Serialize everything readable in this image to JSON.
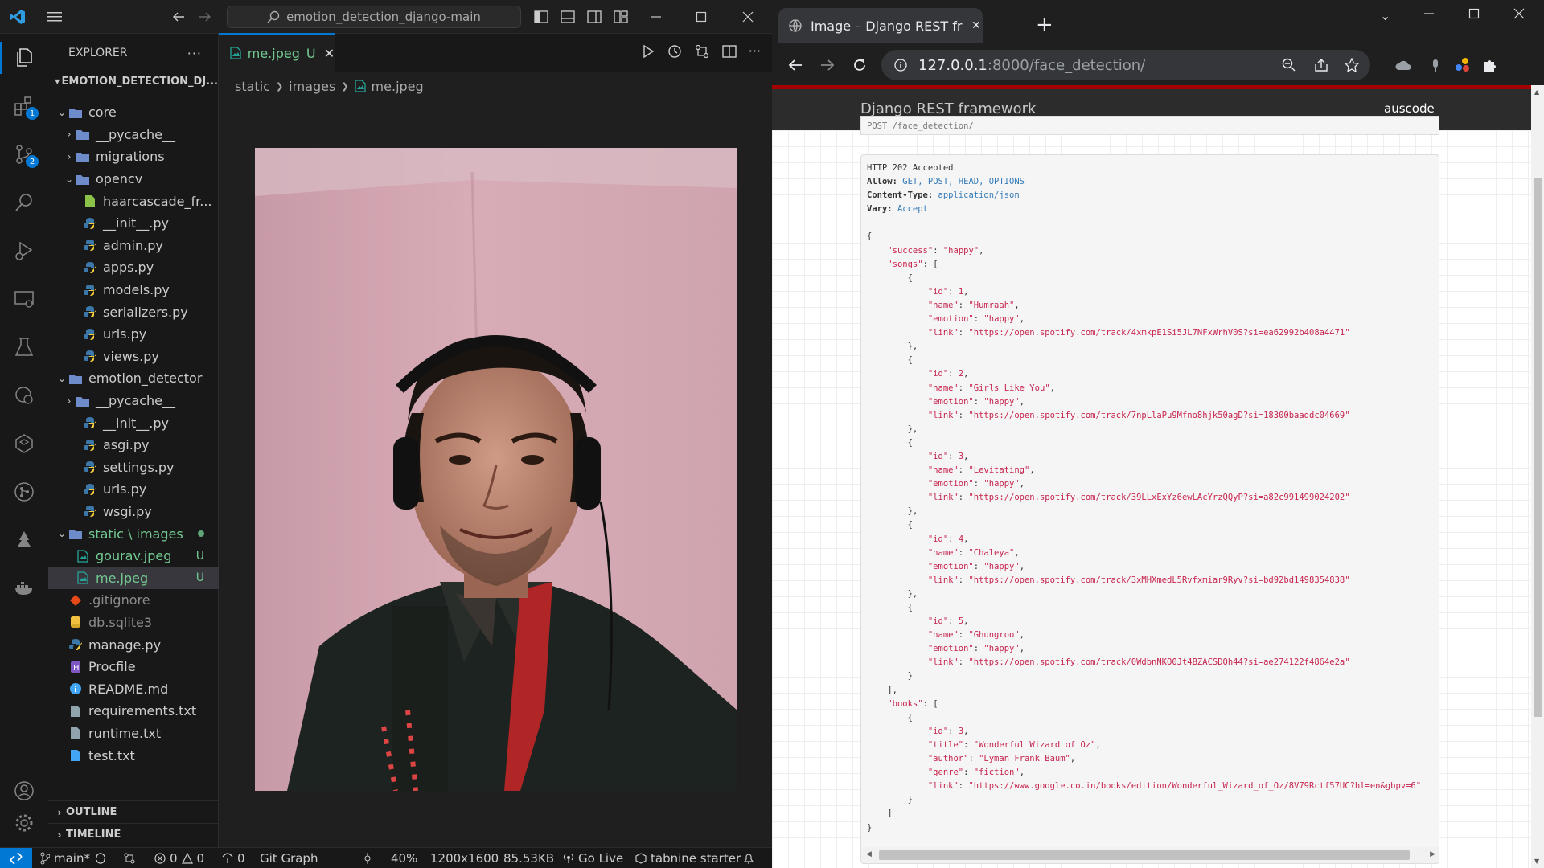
{
  "vscode": {
    "search_text": "emotion_detection_django-main",
    "explorer_title": "EXPLORER",
    "project_name": "EMOTION_DETECTION_DJ...",
    "activity_badges": {
      "extensions": "1",
      "source_control": "2"
    },
    "tree": [
      {
        "label": "core",
        "type": "folder",
        "open": true,
        "indent": 1
      },
      {
        "label": "__pycache__",
        "type": "folder",
        "open": false,
        "indent": 2
      },
      {
        "label": "migrations",
        "type": "folder",
        "open": false,
        "indent": 2
      },
      {
        "label": "opencv",
        "type": "folder",
        "open": true,
        "indent": 2
      },
      {
        "label": "haarcascade_fr...",
        "type": "xml",
        "indent": 3
      },
      {
        "label": "__init__.py",
        "type": "py",
        "indent": 3
      },
      {
        "label": "admin.py",
        "type": "py",
        "indent": 3
      },
      {
        "label": "apps.py",
        "type": "py",
        "indent": 3
      },
      {
        "label": "models.py",
        "type": "py",
        "indent": 3
      },
      {
        "label": "serializers.py",
        "type": "py",
        "indent": 3
      },
      {
        "label": "urls.py",
        "type": "py",
        "indent": 3
      },
      {
        "label": "views.py",
        "type": "py",
        "indent": 3
      },
      {
        "label": "emotion_detector",
        "type": "folder",
        "open": true,
        "indent": 1
      },
      {
        "label": "__pycache__",
        "type": "folder",
        "open": false,
        "indent": 2
      },
      {
        "label": "__init__.py",
        "type": "py",
        "indent": 3
      },
      {
        "label": "asgi.py",
        "type": "py",
        "indent": 3
      },
      {
        "label": "settings.py",
        "type": "py",
        "indent": 3
      },
      {
        "label": "urls.py",
        "type": "py",
        "indent": 3
      },
      {
        "label": "wsgi.py",
        "type": "py",
        "indent": 3
      },
      {
        "label": "static \\ images",
        "type": "folder",
        "open": true,
        "indent": 1,
        "git": "dot"
      },
      {
        "label": "gourav.jpeg",
        "type": "img",
        "indent": 2,
        "git": "U"
      },
      {
        "label": "me.jpeg",
        "type": "img",
        "indent": 2,
        "git": "U",
        "selected": true
      },
      {
        "label": ".gitignore",
        "type": "git",
        "indent": 1
      },
      {
        "label": "db.sqlite3",
        "type": "db",
        "indent": 1
      },
      {
        "label": "manage.py",
        "type": "py",
        "indent": 1
      },
      {
        "label": "Procfile",
        "type": "heroku",
        "indent": 1
      },
      {
        "label": "README.md",
        "type": "info",
        "indent": 1
      },
      {
        "label": "requirements.txt",
        "type": "txt",
        "indent": 1
      },
      {
        "label": "runtime.txt",
        "type": "txt",
        "indent": 1
      },
      {
        "label": "test.txt",
        "type": "txtblue",
        "indent": 1
      }
    ],
    "outline_label": "OUTLINE",
    "timeline_label": "TIMELINE",
    "tab": {
      "label": "me.jpeg",
      "status": "U"
    },
    "breadcrumb": [
      "static",
      "images",
      "me.jpeg"
    ],
    "status": {
      "branch": "main*",
      "errors": "0",
      "warnings": "0",
      "ports": "0",
      "git_graph": "Git Graph",
      "zoom": "40%",
      "dimensions": "1200x1600",
      "size": "85.53KB",
      "go_live": "Go Live",
      "tabnine": "tabnine starter"
    }
  },
  "browser": {
    "tab_title": "Image – Django REST framework",
    "url_host": "127.0.0.1",
    "url_path": ":8000/face_detection/",
    "drf_brand": "Django REST framework",
    "drf_user": "auscode",
    "prev_line": "POST /face_detection/",
    "response": {
      "status": "HTTP 202 Accepted",
      "allow": "GET, POST, HEAD, OPTIONS",
      "content_type": "application/json",
      "vary": "Accept",
      "success": "happy",
      "songs": [
        {
          "id": 1,
          "name": "Humraah",
          "emotion": "happy",
          "link": "https://open.spotify.com/track/4xmkpE1Si5JL7NFxWrhV0S?si=ea62992b408a4471"
        },
        {
          "id": 2,
          "name": "Girls Like You",
          "emotion": "happy",
          "link": "https://open.spotify.com/track/7npLlaPu9Mfno8hjk50agD?si=18300baaddc04669"
        },
        {
          "id": 3,
          "name": "Levitating",
          "emotion": "happy",
          "link": "https://open.spotify.com/track/39LLxExYz6ewLAcYrzQQyP?si=a82c991499024202"
        },
        {
          "id": 4,
          "name": "Chaleya",
          "emotion": "happy",
          "link": "https://open.spotify.com/track/3xMHXmedL5Rvfxmiar9Ryv?si=bd92bd1498354838"
        },
        {
          "id": 5,
          "name": "Ghungroo",
          "emotion": "happy",
          "link": "https://open.spotify.com/track/0WdbnNKO0Jt4BZACSDQh44?si=ae274122f4864e2a"
        }
      ],
      "books": [
        {
          "id": 3,
          "title": "Wonderful Wizard of Oz",
          "author": "Lyman Frank Baum",
          "genre": "fiction",
          "link": "https://www.google.co.in/books/edition/Wonderful_Wizard_of_Oz/8V79Rctf57UC?hl=en&gbpv=6"
        }
      ]
    }
  }
}
